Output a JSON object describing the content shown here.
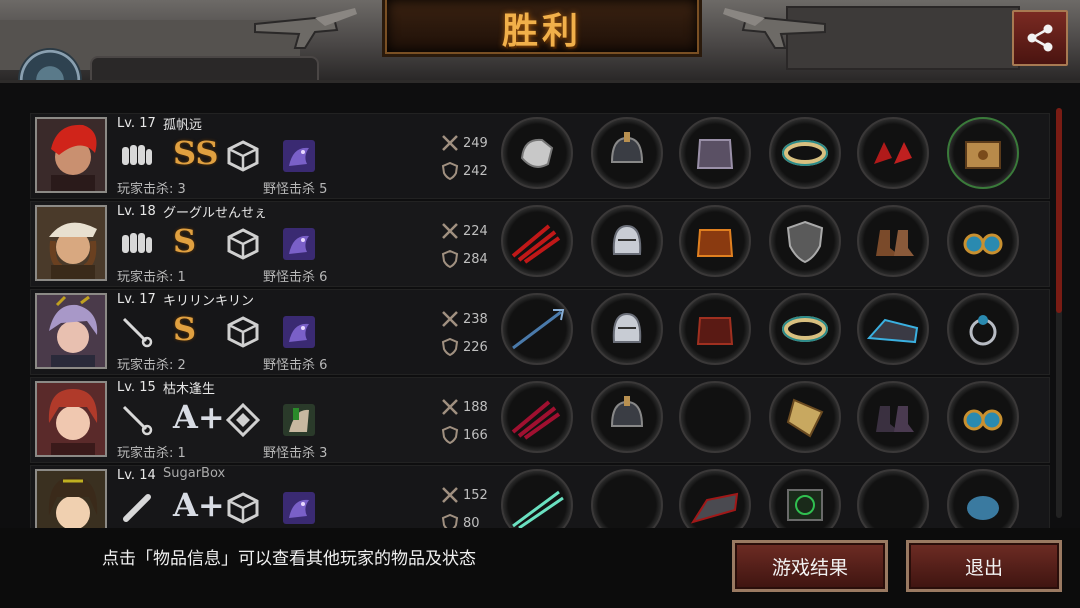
{
  "header": {
    "title": "胜利",
    "share_icon": "share-icon"
  },
  "players": [
    {
      "level": "Lv. 17",
      "name": "孤帆远",
      "weapon_icon": "fist-icon",
      "grade": "SS",
      "player_kills": "玩家击杀: 3",
      "monster_kills": "野怪击杀 5",
      "attack": "249",
      "defense": "242",
      "items": [
        "gauntlet-icon",
        "helmet-icon",
        "armor-icon",
        "bracelet-icon",
        "heels-icon",
        "chest-box-icon"
      ]
    },
    {
      "level": "Lv. 18",
      "name": "グーグルせんせぇ",
      "weapon_icon": "fist-icon",
      "grade": "S",
      "player_kills": "玩家击杀: 1",
      "monster_kills": "野怪击杀 6",
      "attack": "224",
      "defense": "284",
      "items": [
        "claw-icon",
        "knight-helmet-icon",
        "fire-armor-icon",
        "shield-icon",
        "boots-icon",
        "earrings-icon"
      ]
    },
    {
      "level": "Lv. 17",
      "name": "キリリンキリン",
      "weapon_icon": "rapier-icon",
      "grade": "S",
      "player_kills": "玩家击杀: 2",
      "monster_kills": "野怪击杀 6",
      "attack": "238",
      "defense": "226",
      "items": [
        "trident-icon",
        "knight-helmet-icon",
        "red-armor-icon",
        "bracelet-icon",
        "tech-boots-icon",
        "ring-icon"
      ]
    },
    {
      "level": "Lv. 15",
      "name": "枯木逢生",
      "weapon_icon": "rapier-icon",
      "grade": "A+",
      "player_kills": "玩家击杀: 1",
      "monster_kills": "野怪击杀 3",
      "attack": "188",
      "defense": "166",
      "items": [
        "red-claw-icon",
        "helmet-icon",
        "",
        "gold-shield-icon",
        "dark-boots-icon",
        "earrings-icon"
      ]
    },
    {
      "level": "Lv. 14",
      "name": "SugarBox",
      "weapon_icon": "bat-icon",
      "grade": "A+",
      "player_kills": "",
      "monster_kills": "",
      "attack": "152",
      "defense": "80",
      "items": [
        "twin-blades-icon",
        "",
        "boots-icon",
        "radar-icon",
        "",
        "orb-icon"
      ]
    }
  ],
  "footer": {
    "tip": "点击「物品信息」可以查看其他玩家的物品及状态",
    "result_button": "游戏结果",
    "exit_button": "退出"
  },
  "colors": {
    "accent": "#f1b04a",
    "button": "#6e2c24",
    "scroll": "#7a1c14"
  }
}
